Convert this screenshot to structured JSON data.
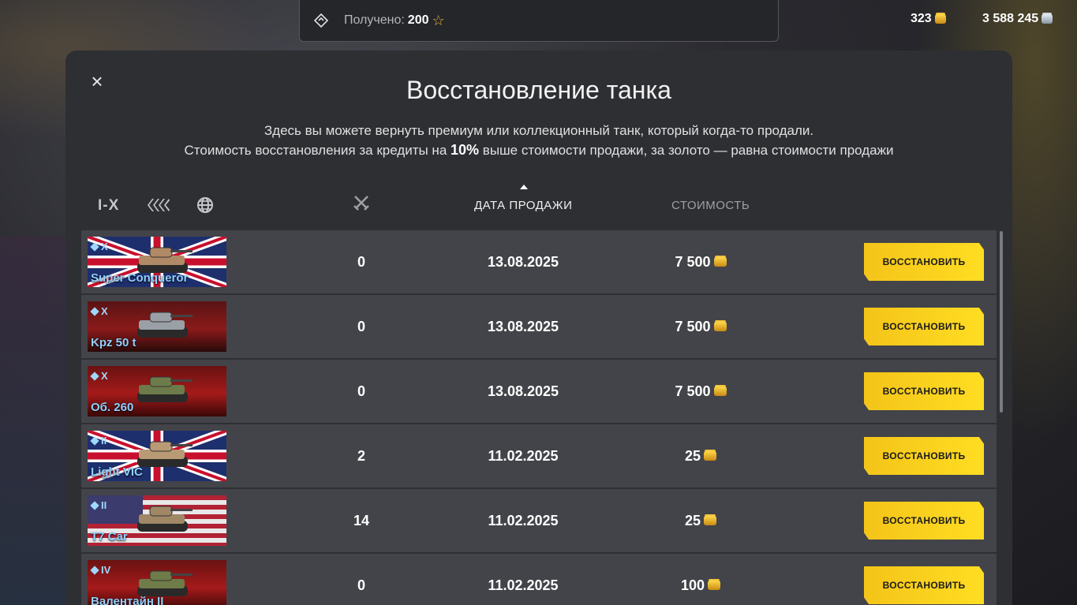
{
  "notification": {
    "label": "Получено:",
    "value": "200",
    "star_icon": "star-icon"
  },
  "currencies": {
    "gold": "323",
    "silver": "3 588 245"
  },
  "dialog": {
    "title": "Восстановление танка",
    "description_line1": "Здесь вы можете вернуть премиум или коллекционный танк, который когда-то продали.",
    "description_line2_prefix": "Стоимость восстановления за кредиты на",
    "description_line2_bold": "10%",
    "description_line2_suffix": "выше стоимости продажи, за золото — равна стоимости продажи",
    "close_icon": "close-icon"
  },
  "filters": {
    "tier": "I-X",
    "type_icon": "tank-type-icon",
    "nation_icon": "globe-icon"
  },
  "columns": {
    "battles_icon": "crossed-swords-icon",
    "date": "ДАТА ПРОДАЖИ",
    "cost": "СТОИМОСТЬ"
  },
  "rows": [
    {
      "tier": "X",
      "name": "Super Conqueror",
      "battles": "0",
      "date": "13.08.2025",
      "cost": "7 500",
      "button": "ВОССТАНОВИТЬ"
    },
    {
      "tier": "X",
      "name": "Kpz 50 t",
      "battles": "0",
      "date": "13.08.2025",
      "cost": "7 500",
      "button": "ВОССТАНОВИТЬ"
    },
    {
      "tier": "X",
      "name": "Об. 260",
      "battles": "0",
      "date": "13.08.2025",
      "cost": "7 500",
      "button": "ВОССТАНОВИТЬ"
    },
    {
      "tier": "II",
      "name": "Light VIC",
      "battles": "2",
      "date": "11.02.2025",
      "cost": "25",
      "button": "ВОССТАНОВИТЬ"
    },
    {
      "tier": "II",
      "name": "T7 Car",
      "battles": "14",
      "date": "11.02.2025",
      "cost": "25",
      "button": "ВОССТАНОВИТЬ"
    },
    {
      "tier": "IV",
      "name": "Валентайн II",
      "battles": "0",
      "date": "11.02.2025",
      "cost": "100",
      "button": "ВОССТАНОВИТЬ"
    }
  ]
}
